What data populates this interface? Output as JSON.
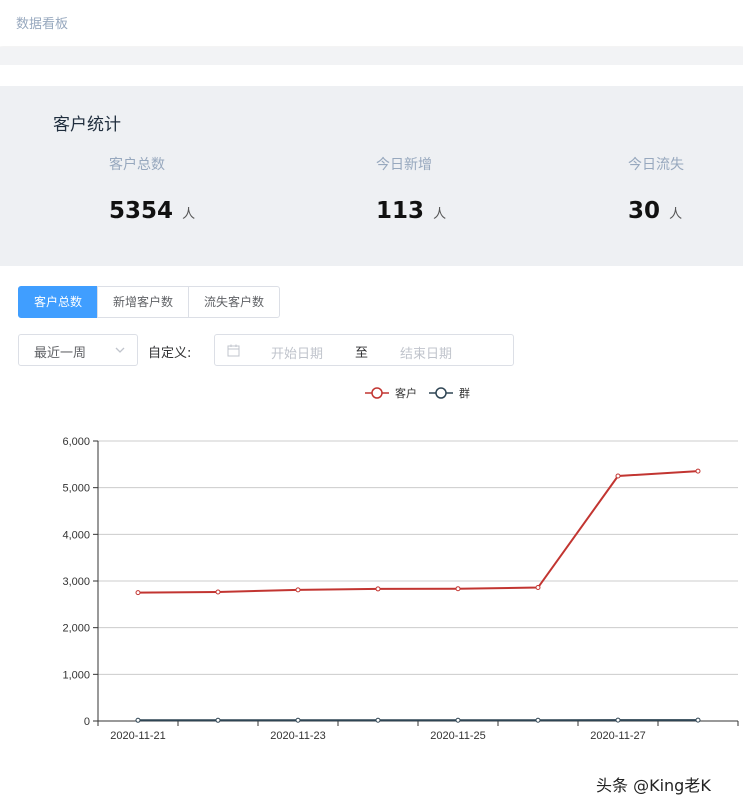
{
  "header": {
    "breadcrumb": "数据看板"
  },
  "stats": {
    "title": "客户统计",
    "items": [
      {
        "label": "客户总数",
        "value": "5354",
        "unit": "人"
      },
      {
        "label": "今日新增",
        "value": "113",
        "unit": "人"
      },
      {
        "label": "今日流失",
        "value": "30",
        "unit": "人"
      }
    ]
  },
  "tabs": [
    {
      "label": "客户总数",
      "active": true
    },
    {
      "label": "新增客户数",
      "active": false
    },
    {
      "label": "流失客户数",
      "active": false
    }
  ],
  "filters": {
    "period_select": "最近一周",
    "custom_label": "自定义:",
    "start_placeholder": "开始日期",
    "range_separator": "至",
    "end_placeholder": "结束日期"
  },
  "icons": {
    "select": "chevron-down-icon",
    "date": "calendar-icon"
  },
  "colors": {
    "accent": "#409eff",
    "series_customer": "#c23531",
    "series_group": "#2f4554"
  },
  "watermark": "头条 @King老K",
  "chart_data": {
    "type": "line",
    "x": [
      "2020-11-21",
      "2020-11-22",
      "2020-11-23",
      "2020-11-24",
      "2020-11-25",
      "2020-11-26",
      "2020-11-27",
      "2020-11-28"
    ],
    "x_tick_labels": [
      "2020-11-21",
      "2020-11-23",
      "2020-11-25",
      "2020-11-27"
    ],
    "series": [
      {
        "name": "客户",
        "color": "#c23531",
        "values": [
          2750,
          2765,
          2810,
          2830,
          2835,
          2860,
          5250,
          5354
        ]
      },
      {
        "name": "群",
        "color": "#2f4554",
        "values": [
          15,
          15,
          16,
          16,
          17,
          17,
          18,
          18
        ]
      }
    ],
    "ylim": [
      0,
      6000
    ],
    "y_ticks": [
      "0",
      "1,000",
      "2,000",
      "3,000",
      "4,000",
      "5,000",
      "6,000"
    ],
    "grid": true,
    "legend": "top-center"
  }
}
